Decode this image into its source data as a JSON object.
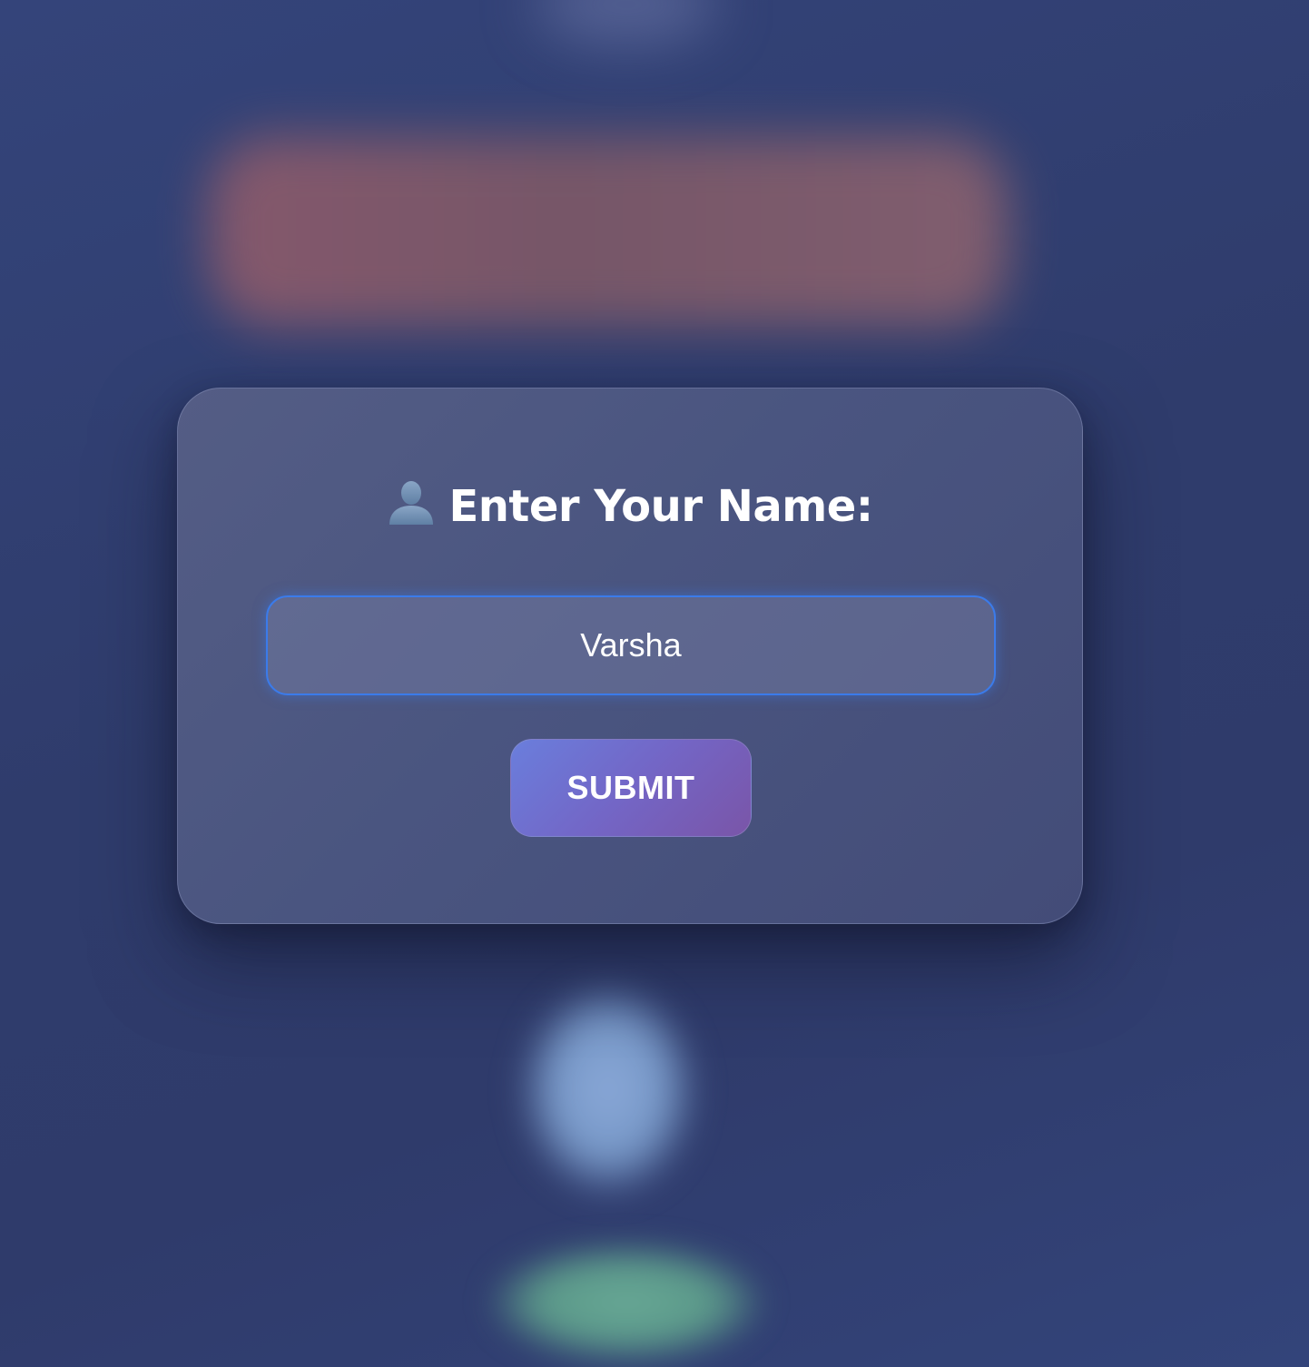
{
  "form": {
    "title": "Enter Your Name:",
    "title_icon": "person-silhouette-icon",
    "name_value": "Varsha",
    "submit_label": "SUBMIT"
  },
  "colors": {
    "background": "#2f3c6c",
    "card": "#4a5580",
    "input_focus_border": "#3b7bea",
    "button_gradient_start": "#6a7edc",
    "button_gradient_end": "#7a55a8",
    "text": "#ffffff"
  }
}
